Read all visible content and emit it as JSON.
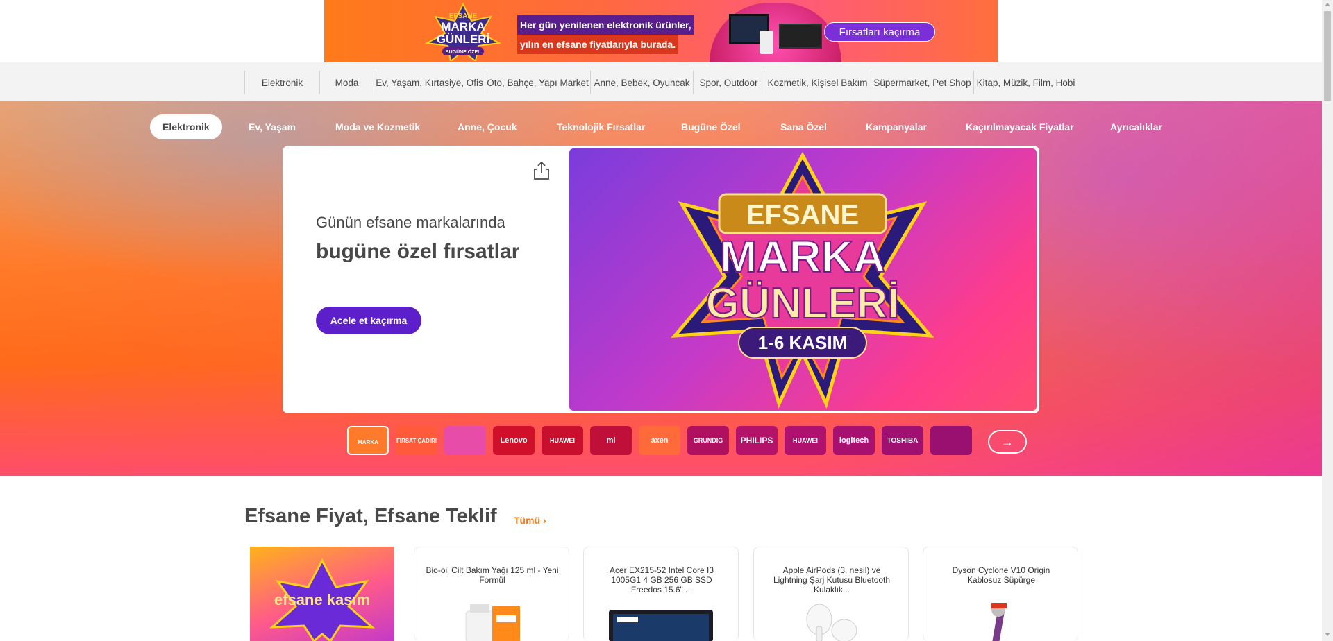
{
  "top_banner": {
    "line1": "Her gün yenilenen elektronik ürünler,",
    "line2": "yılın en efsane fiyatlarıyla burada.",
    "cta": "Fırsatları kaçırma",
    "logo_text": [
      "EFSANE",
      "MARKA",
      "GÜNLERİ",
      "BUGÜNE ÖZEL"
    ]
  },
  "categories": [
    "Elektronik",
    "Moda",
    "Ev, Yaşam, Kırtasiye, Ofis",
    "Oto, Bahçe, Yapı Market",
    "Anne, Bebek, Oyuncak",
    "Spor, Outdoor",
    "Kozmetik, Kişisel Bakım",
    "Süpermarket, Pet Shop",
    "Kitap, Müzik, Film, Hobi"
  ],
  "subnav": [
    "Elektronik",
    "Ev, Yaşam",
    "Moda ve Kozmetik",
    "Anne, Çocuk",
    "Teknolojik Fırsatlar",
    "Bugüne Özel",
    "Sana Özel",
    "Kampanyalar",
    "Kaçırılmayacak Fiyatlar",
    "Ayrıcalıklar"
  ],
  "hero": {
    "subtitle": "Günün efsane markalarında",
    "title": "bugüne özel fırsatlar",
    "button": "Acele et kaçırma",
    "image_text": [
      "EFSANE",
      "MARKA",
      "GÜNLERİ",
      "1-6 KASIM"
    ]
  },
  "brand_thumbs": [
    {
      "label": "MARKA GÜNLERİ",
      "color": "#ff7a2a"
    },
    {
      "label": "FIRSAT ÇADIRI",
      "color": "#ff5a3a"
    },
    {
      "label": "",
      "color": "#e64ca8"
    },
    {
      "label": "Lenovo",
      "color": "#d0102b"
    },
    {
      "label": "HUAWEI",
      "color": "#c8102e"
    },
    {
      "label": "mi",
      "color": "#c0103a"
    },
    {
      "label": "axen",
      "color": "#ff6a3a"
    },
    {
      "label": "GRUNDIG",
      "color": "#b01060"
    },
    {
      "label": "PHILIPS",
      "color": "#b5126a"
    },
    {
      "label": "HUAWEI",
      "color": "#b0106e"
    },
    {
      "label": "logitech",
      "color": "#a81070"
    },
    {
      "label": "TOSHIBA",
      "color": "#a01070"
    },
    {
      "label": "",
      "color": "#9a1070"
    }
  ],
  "section": {
    "title": "Efsane Fiyat, Efsane Teklif",
    "link": "Tümü ›",
    "promo_text": "efsane kasım"
  },
  "products": [
    {
      "name": "Bio-oil Cilt Bakım Yağı 125 ml - Yeni Formül"
    },
    {
      "name": "Acer EX215-52 Intel Core I3 1005G1 4 GB 256 GB SSD Freedos 15.6\" ..."
    },
    {
      "name": "Apple AirPods (3. nesil) ve Lightning Şarj Kutusu Bluetooth Kulaklık..."
    },
    {
      "name": "Dyson Cyclone V10 Origin Kablosuz Süpürge"
    }
  ],
  "colors": {
    "brand_orange": "#f27a1a",
    "cta_purple": "#5d1fc9",
    "text_dark": "#484848"
  }
}
